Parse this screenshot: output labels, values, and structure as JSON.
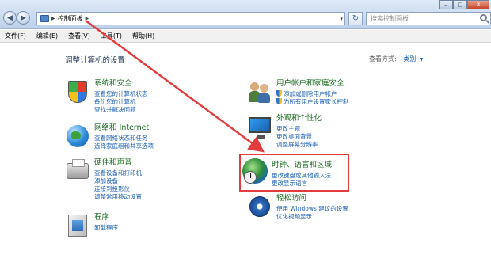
{
  "window": {
    "address_path": "控制面板",
    "search_placeholder": "搜索控制面板"
  },
  "menu": [
    "文件(F)",
    "编辑(E)",
    "查看(V)",
    "工具(T)",
    "帮助(H)"
  ],
  "page": {
    "title": "调整计算机的设置",
    "view_by_label": "查看方式:",
    "view_by_value": "类别"
  },
  "categories": {
    "system_security": {
      "title": "系统和安全",
      "links": [
        "查看您的计算机状态",
        "备份您的计算机",
        "查找并解决问题"
      ]
    },
    "network": {
      "title": "网络和 Internet",
      "links": [
        "查看网络状态和任务",
        "选择家庭组和共享选项"
      ]
    },
    "hardware_sound": {
      "title": "硬件和声音",
      "links": [
        "查看设备和打印机",
        "添加设备",
        "连接到投影仪",
        "调整常用移动设置"
      ]
    },
    "programs": {
      "title": "程序",
      "links": [
        "卸载程序"
      ]
    },
    "user_accounts": {
      "title": "用户帐户和家庭安全",
      "links": [
        "添加或删除用户帐户",
        "为所有用户设置家长控制"
      ]
    },
    "appearance": {
      "title": "外观和个性化",
      "links": [
        "更改主题",
        "更改桌面背景",
        "调整屏幕分辨率"
      ]
    },
    "clock_language_region": {
      "title": "时钟、语言和区域",
      "links": [
        "更改键盘或其他输入法",
        "更改显示语言"
      ]
    },
    "ease_of_access": {
      "title": "轻松访问",
      "links": [
        "使用 Windows 建议的设置",
        "优化视频显示"
      ]
    }
  },
  "annotation": {
    "color": "#e23c3c"
  }
}
